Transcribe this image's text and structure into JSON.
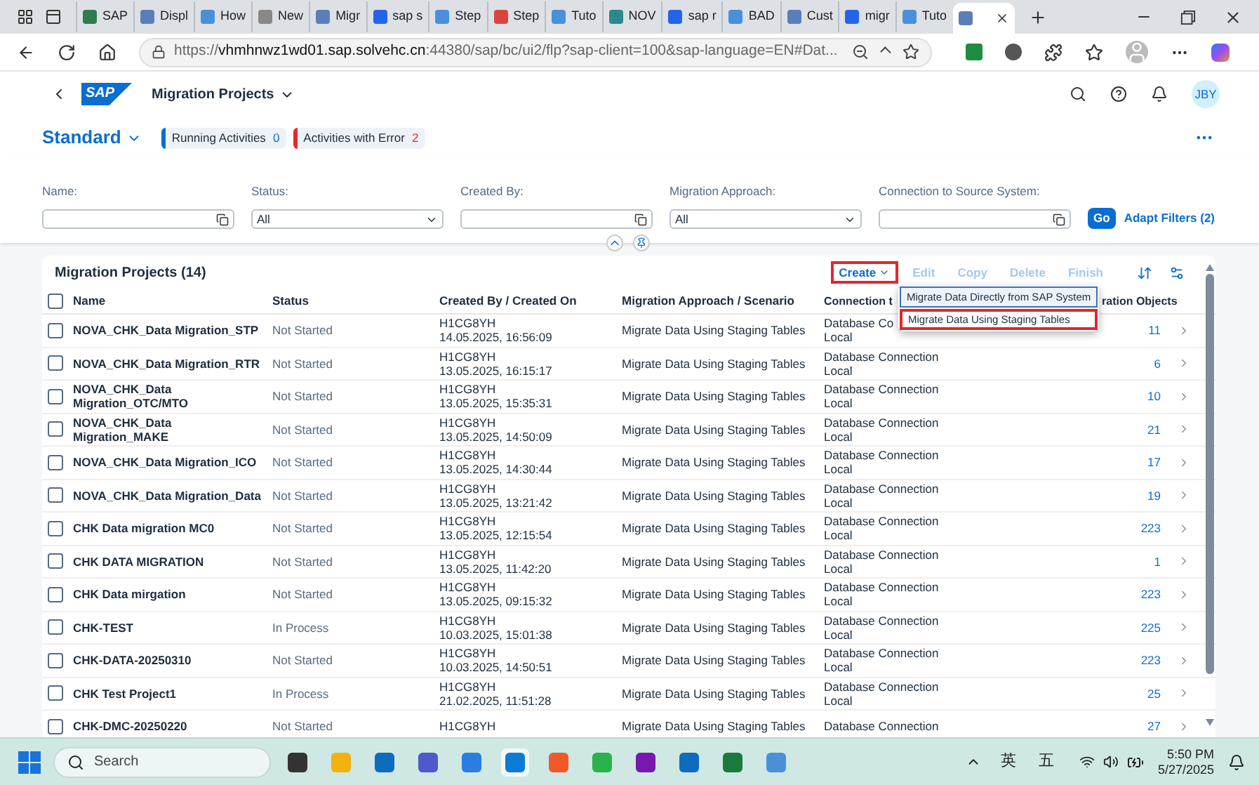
{
  "browser": {
    "tabs": [
      {
        "label": "SAP",
        "selected": false
      },
      {
        "label": "Displ",
        "selected": false
      },
      {
        "label": "How",
        "selected": false
      },
      {
        "label": "New",
        "selected": false
      },
      {
        "label": "Migr",
        "selected": false
      },
      {
        "label": "sap s",
        "selected": false
      },
      {
        "label": "Step",
        "selected": false
      },
      {
        "label": "Step",
        "selected": false
      },
      {
        "label": "Tuto",
        "selected": false
      },
      {
        "label": "NOV",
        "selected": false
      },
      {
        "label": "sap r",
        "selected": false
      },
      {
        "label": "BAD",
        "selected": false
      },
      {
        "label": "Cust",
        "selected": false
      },
      {
        "label": "migr",
        "selected": false
      },
      {
        "label": "Tuto",
        "selected": false
      },
      {
        "selected": true
      }
    ],
    "url_prefix": "https://",
    "url_host": "vhmhnwz1wd01.sap.solvehc.cn",
    "url_rest": ":44380/sap/bc/ui2/flp?sap-client=100&sap-language=EN#Dat..."
  },
  "shell": {
    "logo": "SAP",
    "app_title": "Migration Projects",
    "user": "JBY"
  },
  "header": {
    "variant": "Standard",
    "chips": [
      {
        "label": "Running Activities",
        "count": "0",
        "color": "#0a6ed1"
      },
      {
        "label": "Activities with Error",
        "count": "2",
        "color": "#e9262c"
      }
    ]
  },
  "filters": [
    {
      "label": "Name:",
      "kind": "value_help"
    },
    {
      "label": "Status:",
      "kind": "select",
      "value": "All"
    },
    {
      "label": "Created By:",
      "kind": "value_help"
    },
    {
      "label": "Migration Approach:",
      "kind": "select",
      "value": "All"
    },
    {
      "label": "Connection to Source System:",
      "kind": "value_help"
    }
  ],
  "go": "Go",
  "adapt": "Adapt Filters (2)",
  "table": {
    "title": "Migration Projects (14)",
    "actions": [
      {
        "label": "Create",
        "kind": "menu",
        "disabled": false,
        "highlighted": true
      },
      {
        "label": "Edit",
        "kind": "button",
        "disabled": true,
        "highlighted": false
      },
      {
        "label": "Copy",
        "kind": "button",
        "disabled": true,
        "highlighted": false
      },
      {
        "label": "Delete",
        "kind": "button",
        "disabled": true,
        "highlighted": false
      },
      {
        "label": "Finish",
        "kind": "button",
        "disabled": true,
        "highlighted": false
      }
    ],
    "menu": [
      {
        "label": "Migrate Data Directly from SAP System",
        "focused": true,
        "highlighted": false
      },
      {
        "label": "Migrate Data Using Staging Tables",
        "focused": false,
        "highlighted": true
      }
    ],
    "select_all_checked": false,
    "columns": [
      "Name",
      "Status",
      "Created By / Created On",
      "Migration Approach / Scenario",
      "Connection t",
      "ration Objects"
    ],
    "rows": [
      {
        "name": "NOVA_CHK_Data Migration_STP",
        "status": "Not Started",
        "created_by": "H1CG8YH",
        "created_on": "14.05.2025, 16:56:09",
        "approach": "Migrate Data Using Staging Tables",
        "connection": "Database Co",
        "connection_2": "Local",
        "objects": "11",
        "checked": false
      },
      {
        "name": "NOVA_CHK_Data Migration_RTR",
        "status": "Not Started",
        "created_by": "H1CG8YH",
        "created_on": "13.05.2025, 16:15:17",
        "approach": "Migrate Data Using Staging Tables",
        "connection": "Database Connection",
        "connection_2": "Local",
        "objects": "6",
        "checked": false
      },
      {
        "name": "NOVA_CHK_Data Migration_OTC/MTO",
        "status": "Not Started",
        "created_by": "H1CG8YH",
        "created_on": "13.05.2025, 15:35:31",
        "approach": "Migrate Data Using Staging Tables",
        "connection": "Database Connection",
        "connection_2": "Local",
        "objects": "10",
        "checked": false
      },
      {
        "name": "NOVA_CHK_Data Migration_MAKE",
        "status": "Not Started",
        "created_by": "H1CG8YH",
        "created_on": "13.05.2025, 14:50:09",
        "approach": "Migrate Data Using Staging Tables",
        "connection": "Database Connection",
        "connection_2": "Local",
        "objects": "21",
        "checked": false
      },
      {
        "name": "NOVA_CHK_Data Migration_ICO",
        "status": "Not Started",
        "created_by": "H1CG8YH",
        "created_on": "13.05.2025, 14:30:44",
        "approach": "Migrate Data Using Staging Tables",
        "connection": "Database Connection",
        "connection_2": "Local",
        "objects": "17",
        "checked": false
      },
      {
        "name": "NOVA_CHK_Data Migration_Data",
        "status": "Not Started",
        "created_by": "H1CG8YH",
        "created_on": "13.05.2025, 13:21:42",
        "approach": "Migrate Data Using Staging Tables",
        "connection": "Database Connection",
        "connection_2": "Local",
        "objects": "19",
        "checked": false
      },
      {
        "name": "CHK Data migration MC0",
        "status": "Not Started",
        "created_by": "H1CG8YH",
        "created_on": "13.05.2025, 12:15:54",
        "approach": "Migrate Data Using Staging Tables",
        "connection": "Database Connection",
        "connection_2": "Local",
        "objects": "223",
        "checked": false
      },
      {
        "name": "CHK DATA MIGRATION",
        "status": "Not Started",
        "created_by": "H1CG8YH",
        "created_on": "13.05.2025, 11:42:20",
        "approach": "Migrate Data Using Staging Tables",
        "connection": "Database Connection",
        "connection_2": "Local",
        "objects": "1",
        "checked": false
      },
      {
        "name": "CHK Data mirgation",
        "status": "Not Started",
        "created_by": "H1CG8YH",
        "created_on": "13.05.2025, 09:15:32",
        "approach": "Migrate Data Using Staging Tables",
        "connection": "Database Connection",
        "connection_2": "Local",
        "objects": "223",
        "checked": false
      },
      {
        "name": "CHK-TEST",
        "status": "In Process",
        "created_by": "H1CG8YH",
        "created_on": "10.03.2025, 15:01:38",
        "approach": "Migrate Data Using Staging Tables",
        "connection": "Database Connection",
        "connection_2": "Local",
        "objects": "225",
        "checked": false
      },
      {
        "name": "CHK-DATA-20250310",
        "status": "Not Started",
        "created_by": "H1CG8YH",
        "created_on": "10.03.2025, 14:50:51",
        "approach": "Migrate Data Using Staging Tables",
        "connection": "Database Connection",
        "connection_2": "Local",
        "objects": "223",
        "checked": false
      },
      {
        "name": "CHK Test Project1",
        "status": "In Process",
        "created_by": "H1CG8YH",
        "created_on": "21.02.2025, 11:51:28",
        "approach": "Migrate Data Using Staging Tables",
        "connection": "Database Connection",
        "connection_2": "Local",
        "objects": "25",
        "checked": false
      },
      {
        "name": "CHK-DMC-20250220",
        "status": "Not Started",
        "created_by": "H1CG8YH",
        "approach": "Migrate Data Using Staging Tables",
        "connection": "Database Connection",
        "objects": "27",
        "checked": false
      }
    ]
  },
  "taskbar": {
    "search_placeholder": "Search",
    "ime_1": "英",
    "ime_2": "五",
    "time": "5:50 PM",
    "date": "5/27/2025"
  }
}
